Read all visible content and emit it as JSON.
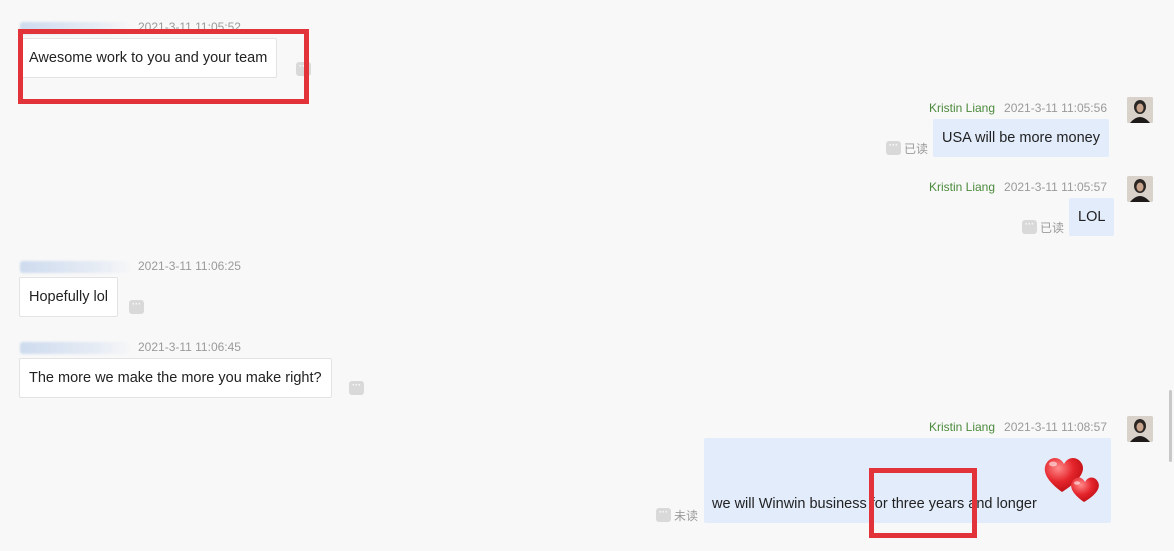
{
  "messages": [
    {
      "side": "left",
      "time": "2021-3-11 11:05:52",
      "text": "Awesome work to you and your team"
    },
    {
      "side": "right",
      "name": "Kristin Liang",
      "time": "2021-3-11 11:05:56",
      "text": "USA will be more money",
      "status": "已读"
    },
    {
      "side": "right",
      "name": "Kristin Liang",
      "time": "2021-3-11 11:05:57",
      "text": "LOL",
      "status": "已读"
    },
    {
      "side": "left",
      "time": "2021-3-11 11:06:25",
      "text": "Hopefully lol"
    },
    {
      "side": "left",
      "time": "2021-3-11 11:06:45",
      "text": "The more we make the more you make right?"
    },
    {
      "side": "right",
      "name": "Kristin Liang",
      "time": "2021-3-11 11:08:57",
      "text": "we will Winwin business for three years and longer",
      "status": "未读",
      "sticker": "hearts-icon"
    }
  ],
  "more_glyph": "···",
  "colors": {
    "highlight": "#e2323a",
    "sender_name": "#4c8a3c",
    "right_bubble": "#e2ecfb",
    "background": "#f8f8f8"
  }
}
